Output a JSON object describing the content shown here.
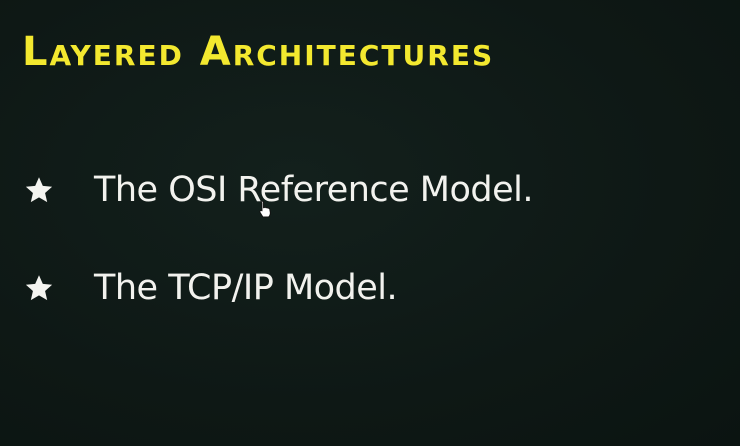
{
  "slide": {
    "title": "Layered Architectures",
    "bullets": [
      {
        "icon": "star-icon",
        "text": "The OSI Reference Model."
      },
      {
        "icon": "star-icon",
        "text": "The TCP/IP Model."
      }
    ]
  },
  "colors": {
    "background": "#0f1a17",
    "title": "#f3e82f",
    "text": "#f2f2ee"
  }
}
